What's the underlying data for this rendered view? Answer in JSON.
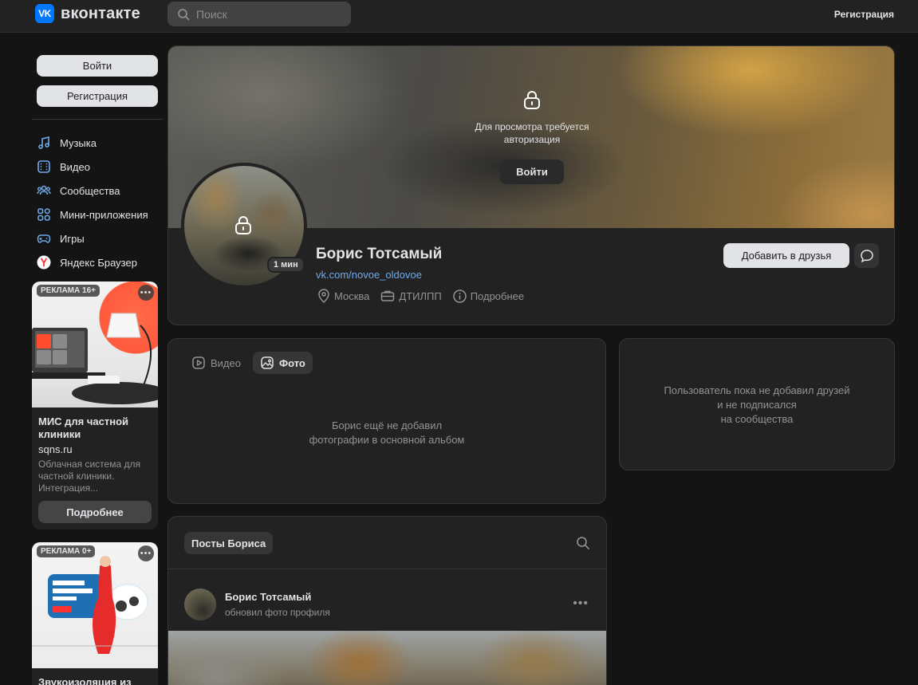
{
  "header": {
    "logo_mark": "VK",
    "logo_text": "вконтакте",
    "search_placeholder": "Поиск",
    "register_link": "Регистрация"
  },
  "sidebar": {
    "login_button": "Войти",
    "register_button": "Регистрация",
    "items": [
      {
        "label": "Музыка",
        "icon": "music-icon"
      },
      {
        "label": "Видео",
        "icon": "video-icon"
      },
      {
        "label": "Сообщества",
        "icon": "communities-icon"
      },
      {
        "label": "Мини-приложения",
        "icon": "mini-apps-icon"
      },
      {
        "label": "Игры",
        "icon": "gamepad-icon"
      },
      {
        "label": "Яндекс Браузер",
        "icon": "yandex-browser-icon"
      }
    ],
    "ads": [
      {
        "badge": "РЕКЛАМА 16+",
        "more": "•••",
        "title": "МИС для частной клиники",
        "domain": "sqns.ru",
        "description": "Облачная система для частной клиники. Интеграция...",
        "button": "Подробнее"
      },
      {
        "badge": "РЕКЛАМА 0+",
        "more": "•••",
        "title": "Звукоизоляция из"
      }
    ]
  },
  "profile": {
    "cover_locked_text": "Для просмотра требуется авторизация",
    "cover_login_button": "Войти",
    "online_badge": "1 мин",
    "name": "Борис Тотсамый",
    "link": "vk.com/novoe_oldovoe",
    "city": "Москва",
    "work": "ДТИЛПП",
    "more_info": "Подробнее",
    "add_friend_button": "Добавить в друзья"
  },
  "media": {
    "tabs": [
      {
        "label": "Видео",
        "active": false
      },
      {
        "label": "Фото",
        "active": true
      }
    ],
    "empty_line1": "Борис ещё не добавил",
    "empty_line2": "фотографии в основной альбом"
  },
  "friends": {
    "empty_line1": "Пользователь пока не добавил друзей",
    "empty_line2": "и не подписался",
    "empty_line3": "на сообщества"
  },
  "posts": {
    "tag": "Посты Бориса",
    "post": {
      "author": "Борис Тотсамый",
      "action": "обновил фото профиля",
      "more": "•••"
    }
  },
  "colors": {
    "accent": "#0077ff",
    "link": "#71aaeb",
    "background": "#141414",
    "card": "#222222"
  }
}
